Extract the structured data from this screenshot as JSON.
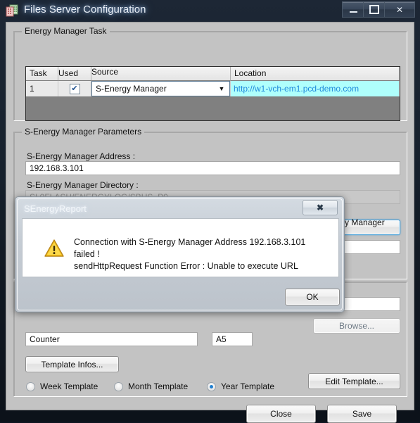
{
  "window": {
    "title": "Files Server Configuration",
    "icon": "files-server-icon",
    "minimize_label": "–",
    "maximize_label": "□",
    "close_label": "✕"
  },
  "energy_manager_task": {
    "group_title": "Energy Manager Task",
    "columns": [
      "Task",
      "Used",
      "Source",
      "Location"
    ],
    "rows": [
      {
        "task": "1",
        "used": true,
        "used_glyph": "✔",
        "source": "S-Energy Manager",
        "source_arrow": "▼",
        "location": "http://w1-vch-em1.pcd-demo.com"
      }
    ]
  },
  "parameters": {
    "group_title": "S-Energy Manager Parameters",
    "address_label": "S-Energy Manager Address :",
    "address_value": "192.168.3.101",
    "directory_label": "S-Energy Manager Directory :",
    "directory_value": "SL0FLASH/ENERGYLOG/SBUS_P0",
    "test_button": "S-Energy Manager Test",
    "extra_value": ""
  },
  "template_section": {
    "browse_button": "Browse...",
    "name_value": "Counter",
    "code_value": "A5",
    "template_infos_button": "Template Infos...",
    "edit_template_button": "Edit Template...",
    "radios": [
      {
        "label": "Week Template",
        "selected": false
      },
      {
        "label": "Month Template",
        "selected": false
      },
      {
        "label": "Year Template",
        "selected": true
      }
    ]
  },
  "footer": {
    "close_button": "Close",
    "save_button": "Save"
  },
  "dialog": {
    "title": "SEnergyReport",
    "close_glyph": "✖",
    "icon": "warning-icon",
    "message_line1": "Connection with S-Energy Manager Address 192.168.3.101 failed !",
    "message_line2": "sendHttpRequest Function Error : Unable to execute URL",
    "ok_button": "OK"
  },
  "colors": {
    "link": "#1f8bdc",
    "selected_row": "#affffc",
    "accent_focus": "#3c9ad6",
    "radio_dot": "#1f7fd0",
    "dialog_bg": "#c5ccd4",
    "client_bg": "#c3c3c3"
  }
}
